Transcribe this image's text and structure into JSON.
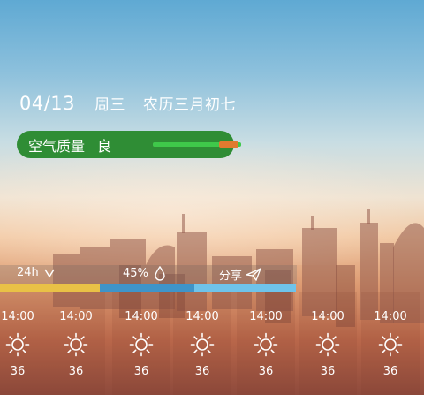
{
  "header": {
    "date": "04/13",
    "weekday": "周三",
    "lunar": "农历三月初七"
  },
  "air_quality": {
    "label": "空气质量",
    "level": "良",
    "bar_color": "#3fc84a",
    "marker_color": "#e07a2f",
    "pill_color": "#2f8d35"
  },
  "controls": {
    "range_label": "24h",
    "humidity": "45%",
    "share_label": "分享"
  },
  "segments": {
    "colors": [
      "#e9c146",
      "#3f94c9",
      "#6fc3ea"
    ]
  },
  "hourly": [
    {
      "time": "14:00",
      "icon": "sun-icon",
      "temp": "36"
    },
    {
      "time": "14:00",
      "icon": "sun-icon",
      "temp": "36"
    },
    {
      "time": "14:00",
      "icon": "sun-icon",
      "temp": "36"
    },
    {
      "time": "14:00",
      "icon": "sun-icon",
      "temp": "36"
    },
    {
      "time": "14:00",
      "icon": "sun-icon",
      "temp": "36"
    },
    {
      "time": "14:00",
      "icon": "sun-icon",
      "temp": "36"
    },
    {
      "time": "14:00",
      "icon": "sun-icon",
      "temp": "36"
    }
  ]
}
